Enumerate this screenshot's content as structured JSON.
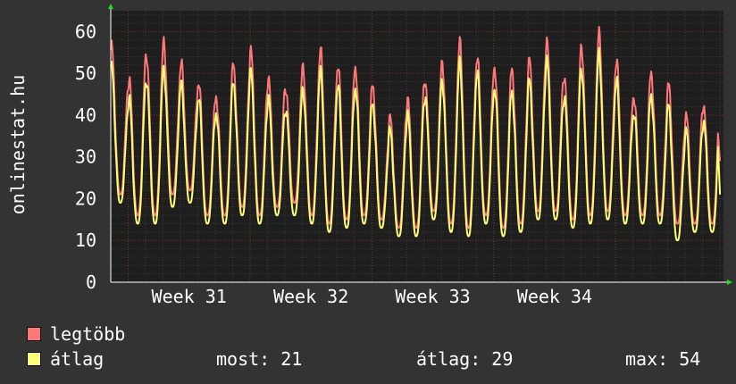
{
  "chart_data": {
    "type": "line",
    "ylabel": "onlinestat.hu",
    "ylim": [
      0,
      65
    ],
    "yticks": [
      0,
      10,
      20,
      30,
      40,
      50,
      60
    ],
    "x_range_days": [
      0,
      35.2
    ],
    "xticks": [
      {
        "label": "Week 31",
        "day": 4.5
      },
      {
        "label": "Week 32",
        "day": 11.5
      },
      {
        "label": "Week 33",
        "day": 18.5
      },
      {
        "label": "Week 34",
        "day": 25.5
      }
    ],
    "grid": true,
    "series": [
      {
        "name": "legtöbb",
        "color": "#ff7777",
        "daily_peaks": [
          56,
          49,
          55,
          57,
          52,
          48,
          45,
          52,
          55,
          49,
          47,
          51,
          55,
          52,
          52,
          47,
          39,
          44,
          49,
          52,
          57,
          54,
          52,
          51,
          53,
          58,
          50,
          56,
          59,
          53,
          45,
          50,
          47,
          40,
          43,
          46
        ],
        "daily_troughs": [
          20,
          21,
          16,
          16,
          21,
          22,
          16,
          16,
          18,
          16,
          18,
          19,
          16,
          14,
          15,
          16,
          15,
          13,
          13,
          17,
          14,
          13,
          16,
          13,
          14,
          17,
          17,
          15,
          16,
          17,
          16,
          16,
          16,
          14,
          14,
          14
        ],
        "last_value": 29
      },
      {
        "name": "átlag",
        "color": "#ffff77",
        "daily_peaks": [
          51,
          44,
          49,
          51,
          47,
          44,
          41,
          48,
          50,
          44,
          42,
          46,
          50,
          47,
          47,
          43,
          36,
          40,
          45,
          48,
          52,
          50,
          47,
          46,
          48,
          53,
          45,
          51,
          54,
          48,
          41,
          45,
          42,
          36,
          39,
          42
        ],
        "daily_troughs": [
          15,
          19,
          14,
          14,
          18,
          19,
          14,
          14,
          16,
          14,
          16,
          16,
          14,
          12,
          13,
          14,
          13,
          11,
          11,
          15,
          12,
          11,
          14,
          11,
          12,
          15,
          15,
          13,
          14,
          15,
          14,
          14,
          14,
          10,
          12,
          12
        ],
        "last_value": 21
      }
    ]
  },
  "legend": {
    "max_label": "legtöbb",
    "avg_label": "átlag",
    "stats": {
      "now": "most: 21",
      "avg": "átlag: 29",
      "max": "max: 54"
    }
  },
  "colors": {
    "background": "#333333",
    "plot_bg": "#1e1e1e",
    "grid_minor": "#3c3c3c",
    "grid_major": "#7a3232",
    "axis": "#ffffff",
    "arrow": "#22dd22"
  }
}
